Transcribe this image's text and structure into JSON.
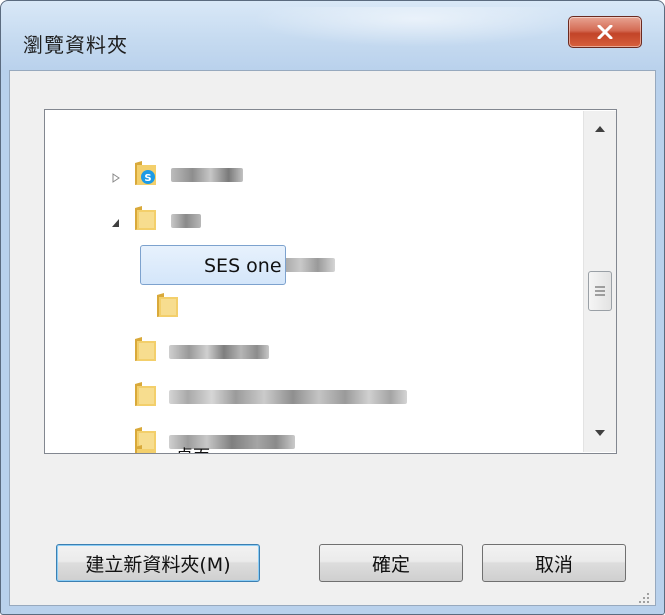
{
  "window": {
    "title": "瀏覽資料夾",
    "close_symbol": "x"
  },
  "tree": {
    "selected_item_label": "SES one",
    "partial_item_label": "桌面"
  },
  "buttons": {
    "new_folder": "建立新資料夾(M)",
    "ok": "確定",
    "cancel": "取消"
  },
  "icons": {
    "folder": "folder-icon",
    "expand": "triangle-right-icon",
    "collapse": "triangle-down-icon",
    "skype": "skype-icon",
    "desktop": "desktop-icon"
  },
  "colors": {
    "selection_border": "#7da2ce",
    "selection_fill": "#d4e6fa",
    "close_button": "#c24428",
    "folder_yellow": "#e8c160"
  }
}
